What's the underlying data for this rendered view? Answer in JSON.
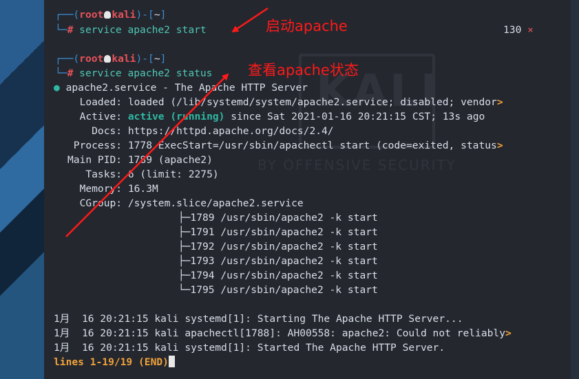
{
  "prompt": {
    "open": "┌──(",
    "user": "root",
    "host": "kali",
    "close": ")-[",
    "dir": "~",
    "end": "]",
    "second": "└─",
    "hash": "#"
  },
  "commands": [
    "service apache2 start",
    "service apache2 status"
  ],
  "exit_code": "130",
  "exit_mark": "×",
  "status": {
    "title": "apache2.service - The Apache HTTP Server",
    "loaded": "  Loaded: loaded (/lib/systemd/system/apache2.service; disabled; vendor",
    "active_label": "  Active: ",
    "active_state": "active (running)",
    "active_rest": " since Sat 2021-01-16 20:21:15 CST; 13s ago",
    "docs": "    Docs: https://httpd.apache.org/docs/2.4/",
    "process": " Process: 1778 ExecStart=/usr/sbin/apachectl start (code=exited, status",
    "main_pid": "Main PID: 1789 (apache2)",
    "tasks": "   Tasks: 6 (limit: 2275)",
    "memory": "  Memory: 16.3M",
    "cgroup": "  CGroup: /system.slice/apache2.service",
    "tree": [
      "          ├─1789 /usr/sbin/apache2 -k start",
      "          ├─1791 /usr/sbin/apache2 -k start",
      "          ├─1792 /usr/sbin/apache2 -k start",
      "          ├─1793 /usr/sbin/apache2 -k start",
      "          ├─1794 /usr/sbin/apache2 -k start",
      "          └─1795 /usr/sbin/apache2 -k start"
    ]
  },
  "journal": [
    "1月  16 20:21:15 kali systemd[1]: Starting The Apache HTTP Server...",
    "1月  16 20:21:15 kali apachectl[1788]: AH00558: apache2: Could not reliably",
    "1月  16 20:21:15 kali systemd[1]: Started The Apache HTTP Server."
  ],
  "overflow_marker": ">",
  "pager": "lines 1-19/19 (END)",
  "annotations": {
    "start": "启动apache",
    "status": "查看apache状态"
  },
  "watermark": {
    "logo": "KALI",
    "tagline": "BY OFFENSIVE SECURITY"
  },
  "colors": {
    "annotation": "#ff1a1a",
    "prompt": "#3c8fd6",
    "user": "#e8525a",
    "active": "#2fb8a4",
    "pager": "#f0a23a"
  }
}
